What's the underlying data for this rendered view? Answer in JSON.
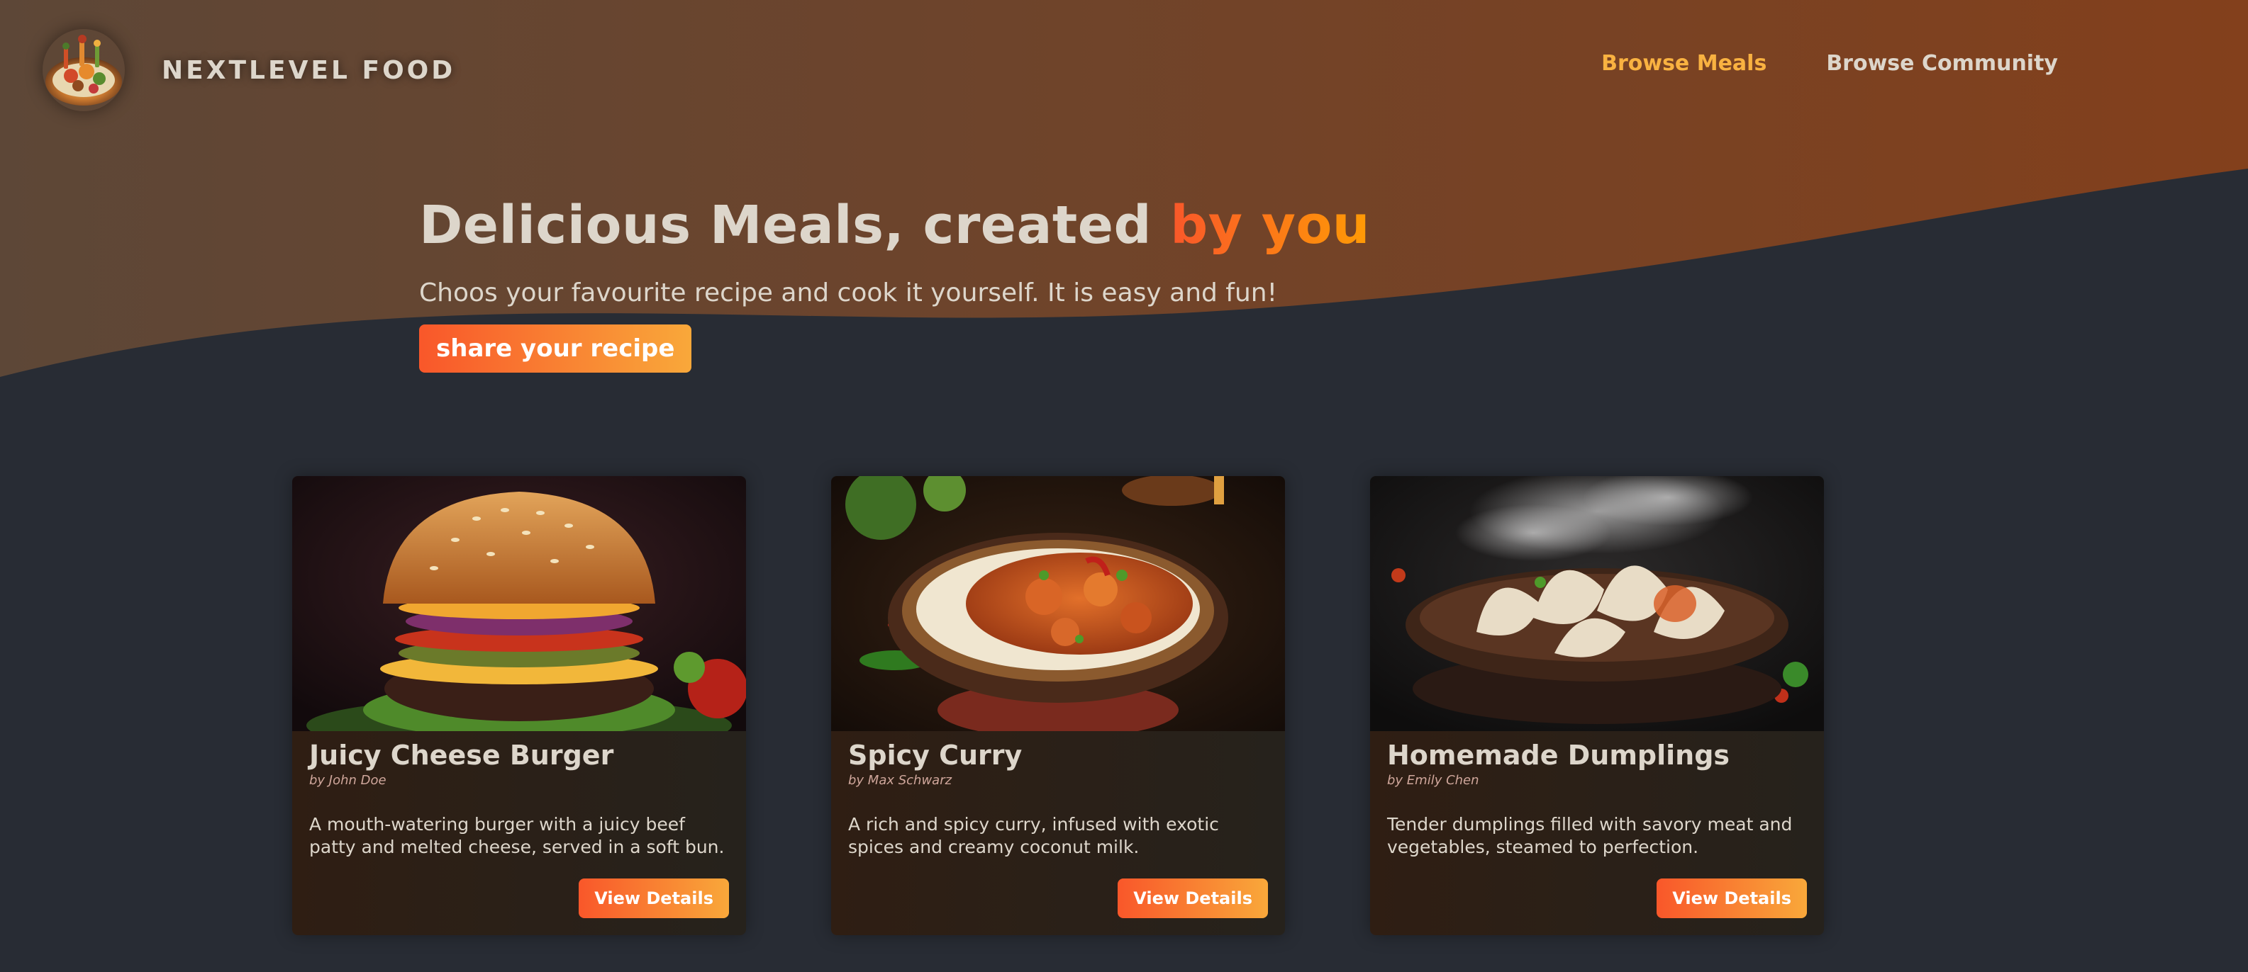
{
  "brand": {
    "name": "NEXTLEVEL FOOD",
    "logo_icon": "food-plate-icon"
  },
  "nav": {
    "items": [
      {
        "label": "Browse Meals",
        "active": true
      },
      {
        "label": "Browse Community",
        "active": false
      }
    ]
  },
  "hero": {
    "title_main": "Delicious Meals, created ",
    "title_accent": "by you",
    "subtitle": "Choos your favourite recipe and cook it yourself. It is easy and fun!",
    "cta_label": "share your recipe"
  },
  "meals": [
    {
      "title": "Juicy Cheese Burger",
      "author": "by John Doe",
      "description": "A mouth-watering burger with a juicy beef patty and melted cheese, served in a soft bun.",
      "button_label": "View Details",
      "image_icon": "burger-photo"
    },
    {
      "title": "Spicy Curry",
      "author": "by Max Schwarz",
      "description": "A rich and spicy curry, infused with exotic spices and creamy coconut milk.",
      "button_label": "View Details",
      "image_icon": "curry-photo"
    },
    {
      "title": "Homemade Dumplings",
      "author": "by Emily Chen",
      "description": "Tender dumplings filled with savory meat and vegetables, steamed to perfection.",
      "button_label": "View Details",
      "image_icon": "dumplings-photo"
    }
  ],
  "colors": {
    "background": "#282c34",
    "accent_start": "#f9572a",
    "accent_end": "#f9a83a",
    "nav_active": "#f9b241",
    "text": "#ddd6cb"
  }
}
